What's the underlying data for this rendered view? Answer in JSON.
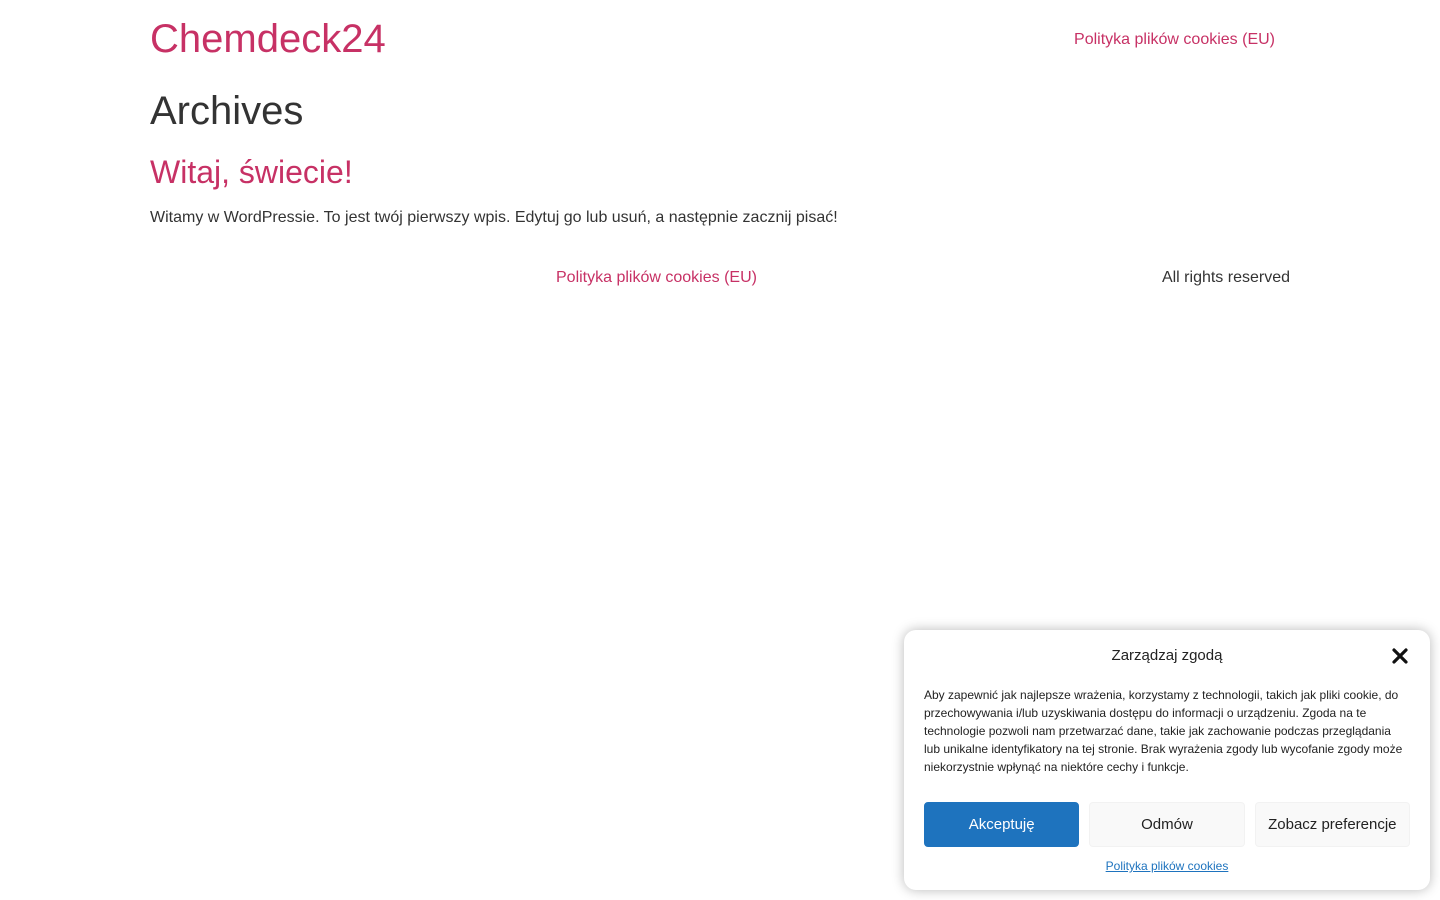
{
  "header": {
    "site_title": "Chemdeck24",
    "nav_link": "Polityka plików cookies (EU)"
  },
  "main": {
    "page_title": "Archives",
    "post": {
      "title": "Witaj, świecie!",
      "excerpt": "Witamy w WordPressie. To jest twój pierwszy wpis. Edytuj go lub usuń, a następnie zacznij pisać!"
    }
  },
  "footer": {
    "link": "Polityka plików cookies (EU)",
    "copyright": "All rights reserved"
  },
  "cookie_banner": {
    "title": "Zarządzaj zgodą",
    "close_icon": "close-icon",
    "message": "Aby zapewnić jak najlepsze wrażenia, korzystamy z technologii, takich jak pliki cookie, do przechowywania i/lub uzyskiwania dostępu do informacji o urządzeniu. Zgoda na te technologie pozwoli nam przetwarzać dane, takie jak zachowanie podczas przeglądania lub unikalne identyfikatory na tej stronie. Brak wyrażenia zgody lub wycofanie zgody może niekorzystnie wpłynąć na niektóre cechy i funkcje.",
    "accept_label": "Akceptuję",
    "deny_label": "Odmów",
    "preferences_label": "Zobacz preferencje",
    "policy_link": "Polityka plików cookies"
  },
  "colors": {
    "accent": "#c73165",
    "button_primary": "#1e73be",
    "text": "#333333"
  }
}
